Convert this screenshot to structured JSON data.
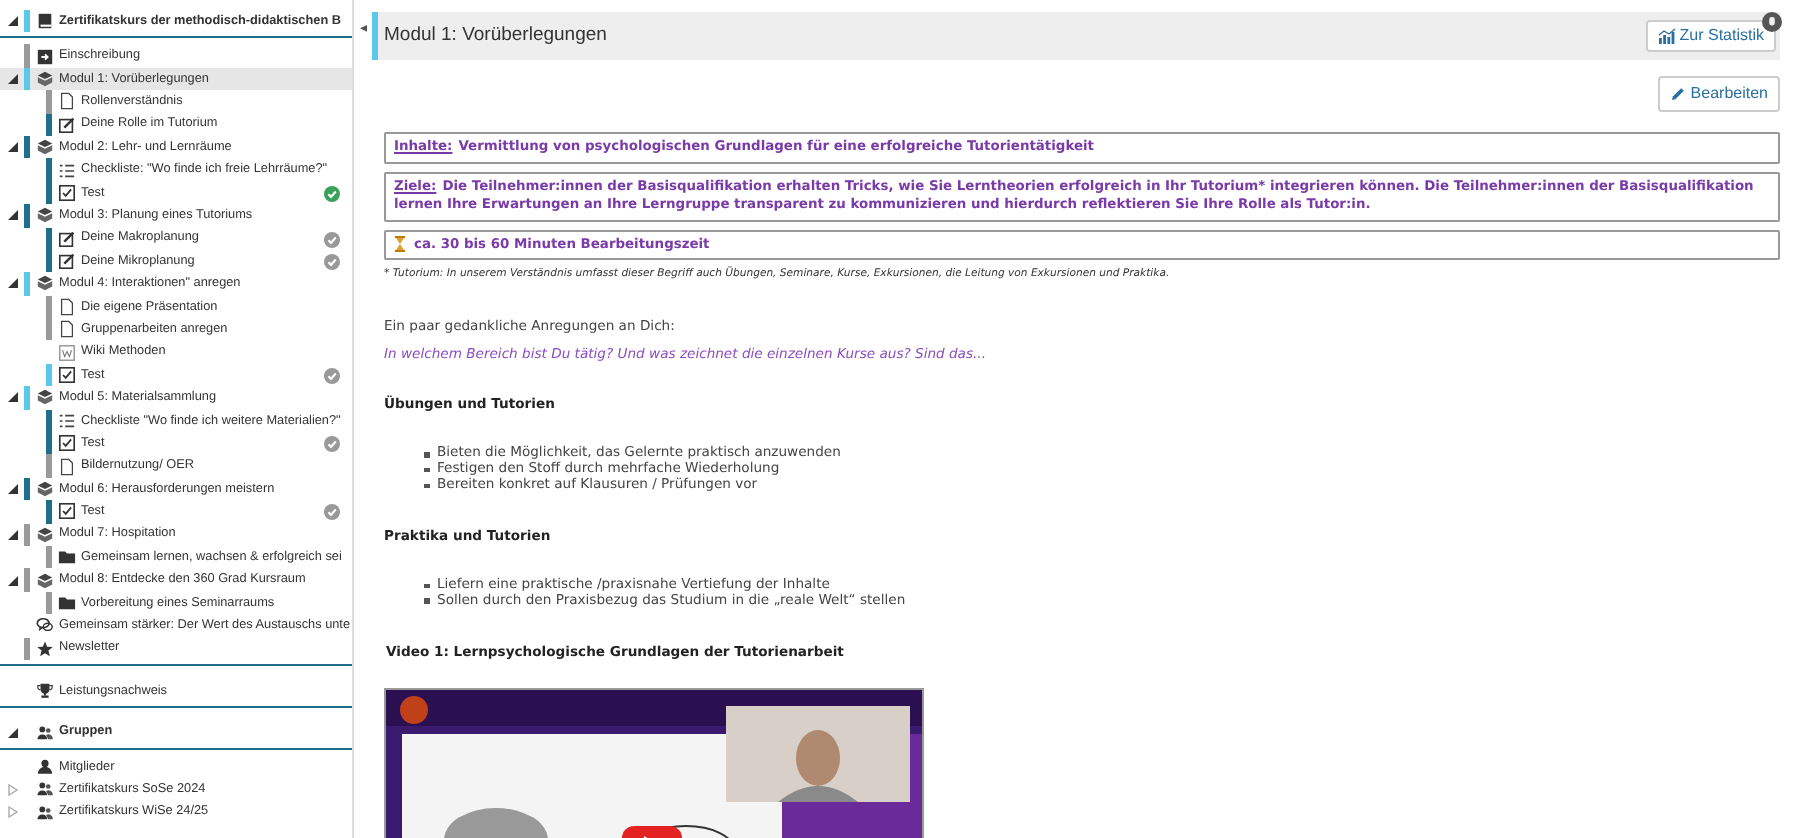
{
  "sidebar": {
    "course": {
      "label": "Zertifikatskurs der methodisch-didaktischen B",
      "kind": "course",
      "expanded": true,
      "color": "#5bc8ea",
      "children": [
        {
          "label": "Einschreibung",
          "kind": "enrollment",
          "color": "#9a9a9a"
        },
        {
          "label": "Modul 1: Vorüberlegungen",
          "kind": "module",
          "expanded": true,
          "selected": true,
          "color": "#5bc8ea",
          "children": [
            {
              "label": "Rollenverständnis",
              "kind": "page",
              "color": "#9a9a9a"
            },
            {
              "label": "Deine Rolle im Tutorium",
              "kind": "task",
              "color": "#1f6e8c"
            }
          ]
        },
        {
          "label": "Modul 2: Lehr- und Lernräume",
          "kind": "module",
          "expanded": true,
          "selected": false,
          "color": "#1f6e8c",
          "children": [
            {
              "label": "Checkliste: \"Wo finde ich freie Lehrräume?\"",
              "kind": "checklist",
              "color": "#1f6e8c"
            },
            {
              "label": "Test",
              "kind": "test",
              "color": "#1f6e8c",
              "completed": true,
              "passed": true
            }
          ]
        },
        {
          "label": "Modul 3: Planung eines Tutoriums",
          "kind": "module",
          "expanded": true,
          "selected": false,
          "color": "#1f6e8c",
          "children": [
            {
              "label": "Deine Makroplanung",
              "kind": "task",
              "color": "#1f6e8c",
              "completed": true,
              "passed": false
            },
            {
              "label": "Deine Mikroplanung",
              "kind": "task",
              "color": "#1f6e8c",
              "completed": true,
              "passed": false
            }
          ]
        },
        {
          "label": "Modul 4: Interaktionen\" anregen",
          "kind": "module",
          "expanded": true,
          "selected": false,
          "color": "#5bc8ea",
          "children": [
            {
              "label": "Die eigene Präsentation",
              "kind": "page",
              "color": "#9a9a9a"
            },
            {
              "label": "Gruppenarbeiten anregen",
              "kind": "page",
              "color": "#9a9a9a"
            },
            {
              "label": "Wiki Methoden",
              "kind": "wiki"
            },
            {
              "label": "Test",
              "kind": "test",
              "color": "#5bc8ea",
              "completed": true,
              "passed": false
            }
          ]
        },
        {
          "label": "Modul 5: Materialsammlung",
          "kind": "module",
          "expanded": true,
          "selected": false,
          "color": "#5bc8ea",
          "children": [
            {
              "label": "Checkliste \"Wo finde ich weitere Materialien?\"",
              "kind": "checklist",
              "color": "#1f6e8c"
            },
            {
              "label": "Test",
              "kind": "test",
              "color": "#1f6e8c",
              "completed": true,
              "passed": false
            },
            {
              "label": "Bildernutzung/ OER",
              "kind": "page",
              "color": "#9a9a9a"
            }
          ]
        },
        {
          "label": "Modul 6: Herausforderungen meistern",
          "kind": "module",
          "expanded": true,
          "selected": false,
          "color": "#1f6e8c",
          "children": [
            {
              "label": "Test",
              "kind": "test",
              "color": "#1f6e8c",
              "completed": true,
              "passed": false
            }
          ]
        },
        {
          "label": "Modul 7: Hospitation",
          "kind": "module",
          "expanded": true,
          "selected": false,
          "color": "#9a9a9a",
          "children": [
            {
              "label": "Gemeinsam lernen, wachsen & erfolgreich sei",
              "kind": "folder",
              "color": "#9a9a9a"
            }
          ]
        },
        {
          "label": "Modul 8: Entdecke den 360 Grad Kursraum",
          "kind": "module",
          "expanded": true,
          "selected": false,
          "color": "#9a9a9a",
          "children": [
            {
              "label": "Vorbereitung eines Seminarraums",
              "kind": "folder",
              "color": "#9a9a9a"
            }
          ]
        },
        {
          "label": "Gemeinsam stärker: Der Wert des Austauschs unte",
          "kind": "forum"
        },
        {
          "label": "Newsletter",
          "kind": "star",
          "color": "#9a9a9a"
        }
      ]
    },
    "extra": [
      {
        "label": "Leistungsnachweis",
        "kind": "trophy"
      },
      {
        "label": "Gruppen",
        "kind": "group",
        "expanded": true,
        "header": true,
        "children": [
          {
            "label": "Mitglieder",
            "kind": "members"
          },
          {
            "label": "Zertifikatskurs SoSe 2024",
            "kind": "group",
            "expanded": false
          },
          {
            "label": "Zertifikatskurs WiSe 24/25",
            "kind": "group",
            "expanded": false
          }
        ]
      }
    ]
  },
  "main": {
    "toggle": "◂",
    "title": "Modul 1: Vorüberlegungen",
    "stats_button": "Zur Statistik",
    "edit_button": "Bearbeiten",
    "boxes": [
      {
        "kind": "labeled",
        "label": "Inhalte:",
        "text": "Vermittlung von psychologischen Grundlagen für eine erfolgreiche Tutorientätigkeit"
      },
      {
        "kind": "labeled",
        "label": "Ziele:",
        "text": "Die Teilnehmer:innen der Basisqualifikation erhalten Tricks, wie Sie Lerntheorien erfolgreich in Ihr Tutorium* integrieren können. Die Teilnehmer:innen der Basisqualifikation lernen Ihre Erwartungen an Ihre Lerngruppe transparent zu kommunizieren und hierdurch reflektieren Sie Ihre Rolle als Tutor:in."
      },
      {
        "kind": "time",
        "text": "ca. 30 bis 60 Minuten Bearbeitungszeit"
      }
    ],
    "footnote": "* Tutorium: In unserem Verständnis umfasst dieser Begriff auch Übungen, Seminare, Kurse, Exkursionen, die Leitung von Exkursionen und Praktika.",
    "intro": "Ein paar gedankliche Anregungen an Dich:",
    "question": "In welchem Bereich bist Du tätig? Und was zeichnet die einzelnen Kurse aus? Sind das...",
    "sections": [
      {
        "heading": "Übungen und Tutorien",
        "items": [
          "Bieten die Möglichkeit, das Gelernte praktisch anzuwenden",
          "Festigen den Stoff durch mehrfache Wiederholung",
          "Bereiten konkret auf Klausuren / Prüfungen vor"
        ]
      },
      {
        "heading": "Praktika und Tutorien",
        "items": [
          "Liefern eine praktische /praxisnahe Vertiefung der Inhalte",
          "Sollen durch den Praxisbezug das Studium in die „reale Welt“ stellen"
        ]
      }
    ],
    "video_heading": "Video 1: Lernpsychologische Grundlagen der Tutorienarbeit"
  }
}
